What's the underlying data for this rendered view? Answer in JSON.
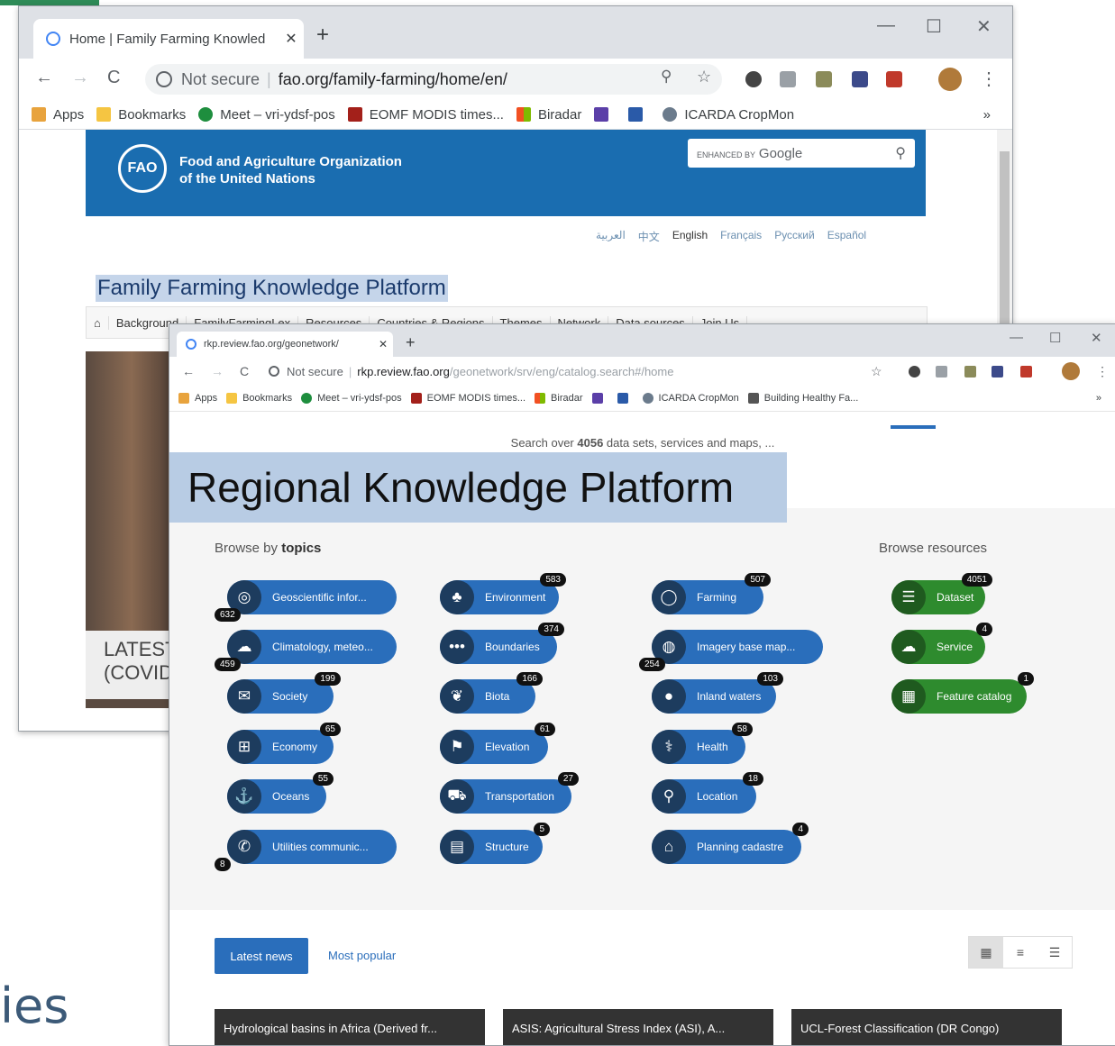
{
  "slide": {
    "bottom_text": "ies"
  },
  "win1": {
    "tab_title": "Home | Family Farming Knowled",
    "close": "✕",
    "new_tab": "+",
    "omnibox": {
      "security": "Not secure",
      "url": "fao.org/family-farming/home/en/"
    },
    "bookmarks": [
      "Apps",
      "Bookmarks",
      "Meet – vri-ydsf-pos",
      "EOMF MODIS times...",
      "Biradar",
      "",
      "",
      "ICARDA CropMon"
    ],
    "fao": {
      "logo": "FAO",
      "name_line1": "Food and Agriculture Organization",
      "name_line2": "of the United Nations",
      "search_label": "ENHANCED BY",
      "search_brand": "Google"
    },
    "languages": [
      "العربية",
      "中文",
      "English",
      "Français",
      "Русский",
      "Español"
    ],
    "platform_title": "Family Farming Knowledge Platform",
    "menu": [
      "Background",
      "FamilyFarmingLex",
      "Resources",
      "Countries & Regions",
      "Themes",
      "Network",
      "Data sources",
      "Join Us"
    ],
    "hero_caption_1": "LATEST",
    "hero_caption_2": "(COVID"
  },
  "win2": {
    "tab_title": "rkp.review.fao.org/geonetwork/",
    "close": "✕",
    "new_tab": "+",
    "omnibox": {
      "security": "Not secure",
      "host": "rkp.review.fao.org",
      "path": "/geonetwork/srv/eng/catalog.search#/home"
    },
    "bookmarks": [
      "Apps",
      "Bookmarks",
      "Meet – vri-ydsf-pos",
      "EOMF MODIS times...",
      "Biradar",
      "",
      "",
      "ICARDA CropMon",
      "Building Healthy Fa..."
    ],
    "search_over_pre": "Search over",
    "search_over_count": "4056",
    "search_over_post": "data sets, services and maps, ...",
    "overlay_title": "Regional Knowledge Platform",
    "browse_by": "Browse by",
    "topics_word": "topics",
    "browse_resources": "Browse resources",
    "topics": [
      {
        "label": "Geoscientific infor...",
        "count": "632",
        "icon": "globe-icon"
      },
      {
        "label": "Climatology, meteo...",
        "count": "459",
        "icon": "cloud-icon"
      },
      {
        "label": "Society",
        "count": "199",
        "icon": "comments-icon"
      },
      {
        "label": "Economy",
        "count": "65",
        "icon": "cart-icon"
      },
      {
        "label": "Oceans",
        "count": "55",
        "icon": "anchor-icon"
      },
      {
        "label": "Utilities communic...",
        "count": "8",
        "icon": "phone-icon"
      },
      {
        "label": "Environment",
        "count": "583",
        "icon": "tree-icon"
      },
      {
        "label": "Boundaries",
        "count": "374",
        "icon": "dots-icon"
      },
      {
        "label": "Biota",
        "count": "166",
        "icon": "leaf-icon"
      },
      {
        "label": "Elevation",
        "count": "61",
        "icon": "flag-icon"
      },
      {
        "label": "Transportation",
        "count": "27",
        "icon": "truck-icon"
      },
      {
        "label": "Structure",
        "count": "5",
        "icon": "building-icon"
      },
      {
        "label": "Farming",
        "count": "507",
        "icon": "farming-icon"
      },
      {
        "label": "Imagery base map...",
        "count": "254",
        "icon": "earth-icon"
      },
      {
        "label": "Inland waters",
        "count": "103",
        "icon": "drop-icon"
      },
      {
        "label": "Health",
        "count": "58",
        "icon": "stethoscope-icon"
      },
      {
        "label": "Location",
        "count": "18",
        "icon": "map-marker-icon"
      },
      {
        "label": "Planning cadastre",
        "count": "4",
        "icon": "home-icon"
      }
    ],
    "resources": [
      {
        "label": "Dataset",
        "count": "4051",
        "icon": "database-icon"
      },
      {
        "label": "Service",
        "count": "4",
        "icon": "cloud-icon"
      },
      {
        "label": "Feature catalog",
        "count": "1",
        "icon": "table-icon"
      }
    ],
    "latest_news": "Latest news",
    "most_popular": "Most popular",
    "news": [
      "Hydrological basins in Africa (Derived fr...",
      "ASIS: Agricultural Stress Index (ASI), A...",
      "UCL-Forest Classification (DR Congo)"
    ]
  }
}
